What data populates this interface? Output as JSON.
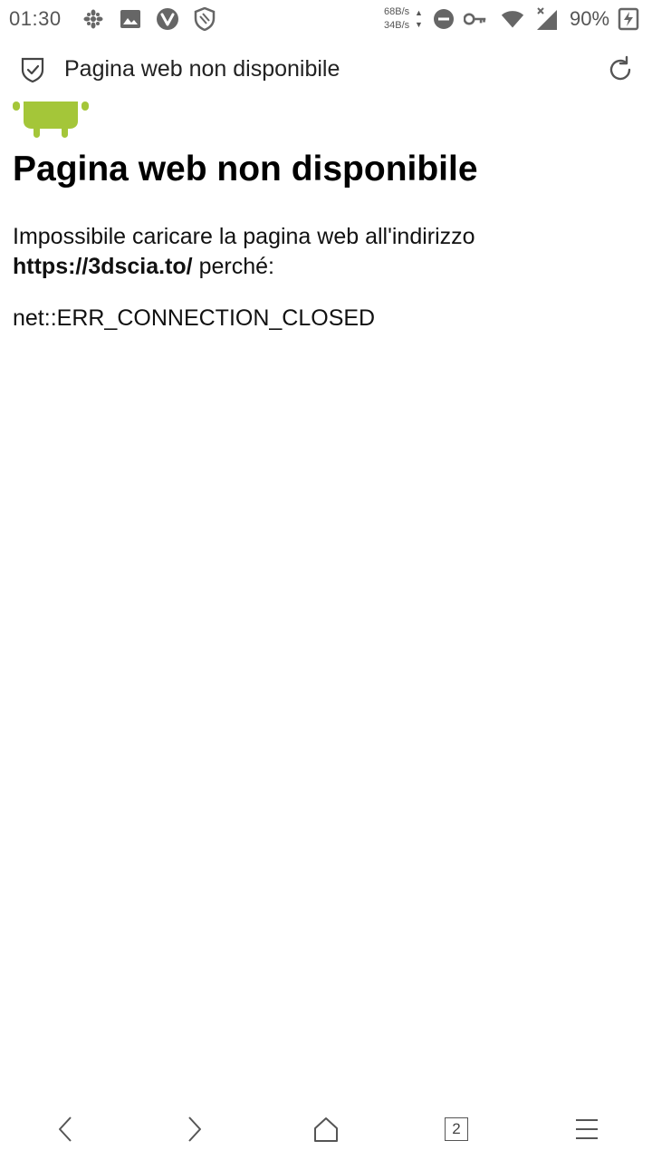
{
  "status_bar": {
    "time": "01:30",
    "net_down": "68B/s",
    "net_up": "34B/s",
    "battery": "90%",
    "icons": [
      "settings-flower-icon",
      "image-icon",
      "vivaldi-icon",
      "shield-icon",
      "dnd-icon",
      "vpn-key-icon",
      "wifi-icon",
      "signal-icon",
      "battery-charging-icon"
    ]
  },
  "toolbar": {
    "title": "Pagina web non disponibile"
  },
  "error_page": {
    "heading": "Pagina web non disponibile",
    "message_before": "Impossibile caricare la pagina web all'indirizzo",
    "url": "https://3dscia.to/",
    "message_after": " perché:",
    "error_code": "net::ERR_CONNECTION_CLOSED",
    "logo_color": "#A4C639"
  },
  "bottom_nav": {
    "tab_count": "2",
    "icons": [
      "back-icon",
      "forward-icon",
      "home-icon",
      "tabs-icon",
      "menu-icon"
    ]
  }
}
